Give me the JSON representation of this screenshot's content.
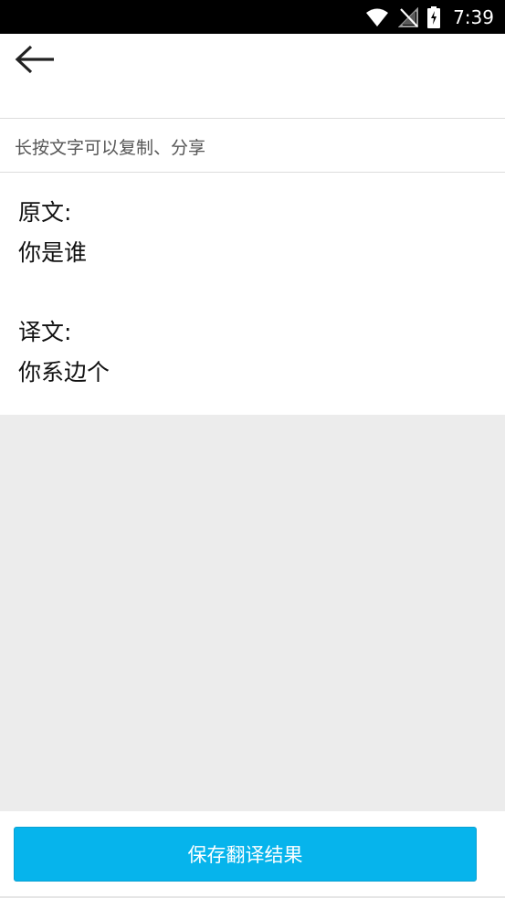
{
  "status_bar": {
    "time": "7:39",
    "icons": [
      "wifi-icon",
      "no-signal-icon",
      "battery-charging-icon"
    ]
  },
  "toolbar": {
    "back_icon": "arrow-left-icon"
  },
  "hint": "长按文字可以复制、分享",
  "content": {
    "original_label": "原文:",
    "original_text": "你是谁",
    "translation_label": "译文:",
    "translation_text": "你系边个"
  },
  "save_button_label": "保存翻译结果",
  "colors": {
    "accent": "#06b4ec",
    "gray_area": "#ececec"
  }
}
